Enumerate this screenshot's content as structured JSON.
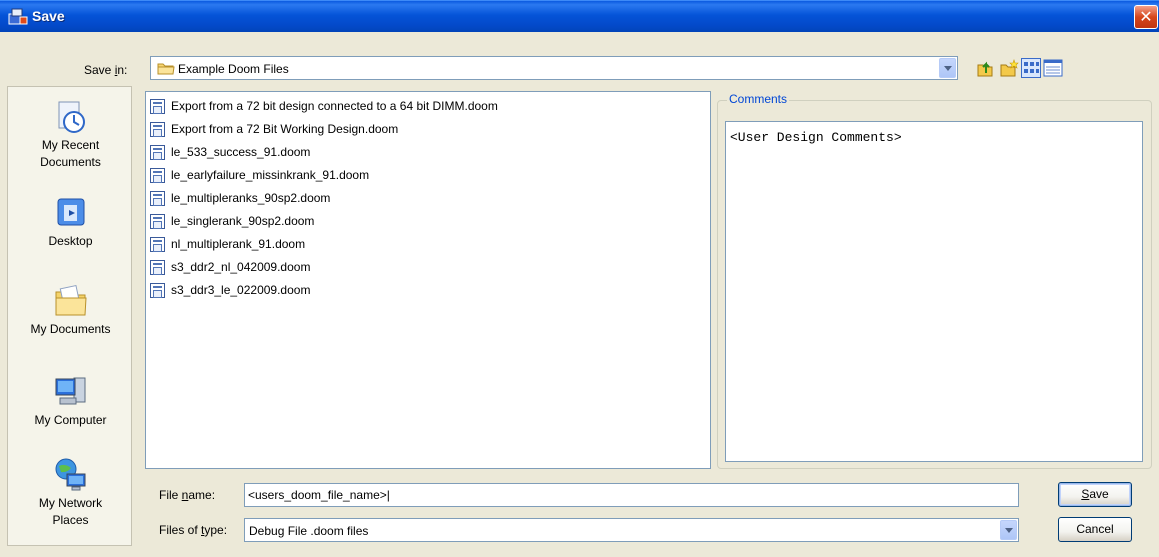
{
  "window": {
    "title": "Save",
    "close_glyph": "✕"
  },
  "save_in": {
    "label_prefix": "Save ",
    "label_underlined": "i",
    "label_suffix": "n:",
    "folder": "Example Doom Files"
  },
  "toolbar": {
    "icons": [
      "up-folder-icon",
      "new-folder-icon",
      "list-view-icon",
      "details-view-icon"
    ]
  },
  "places": [
    {
      "label_line1": "My Recent",
      "label_line2": "Documents",
      "icon": "recent-documents-icon"
    },
    {
      "label_line1": "Desktop",
      "label_line2": "",
      "icon": "desktop-icon"
    },
    {
      "label_line1": "My Documents",
      "label_line2": "",
      "icon": "my-documents-icon"
    },
    {
      "label_line1": "My Computer",
      "label_line2": "",
      "icon": "my-computer-icon"
    },
    {
      "label_line1": "My Network",
      "label_line2": "Places",
      "icon": "network-places-icon"
    }
  ],
  "files": [
    "Export from a 72 bit design connected to a 64 bit DIMM.doom",
    "Export from a 72 Bit Working Design.doom",
    "le_533_success_91.doom",
    "le_earlyfailure_missinkrank_91.doom",
    "le_multipleranks_90sp2.doom",
    "le_singlerank_90sp2.doom",
    "nl_multiplerank_91.doom",
    "s3_ddr2_nl_042009.doom",
    "s3_ddr3_le_022009.doom"
  ],
  "comments": {
    "legend": "Comments",
    "text": "<User Design Comments>"
  },
  "file_name": {
    "label_prefix": "File ",
    "label_underlined": "n",
    "label_suffix": "ame:",
    "value": "<users_doom_file_name>|"
  },
  "file_type": {
    "label_prefix": "Files of ",
    "label_underlined": "t",
    "label_suffix": "ype:",
    "value": "Debug File .doom files"
  },
  "buttons": {
    "save_underlined": "S",
    "save_rest": "ave",
    "cancel": "Cancel"
  },
  "colors": {
    "title_bar": "#0554d8",
    "dialog_bg": "#ece9d8",
    "comments_legend": "#0046d5"
  }
}
